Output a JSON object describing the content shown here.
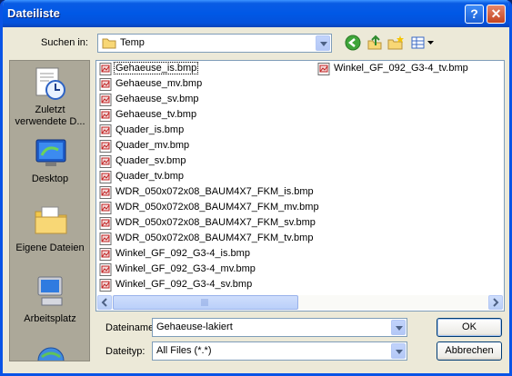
{
  "window": {
    "title": "Dateiliste"
  },
  "titlebar_buttons": {
    "help": "?",
    "close": "✕"
  },
  "lookin": {
    "label": "Suchen in:",
    "value": "Temp"
  },
  "toolbar_icons": [
    "back-icon",
    "up-folder-icon",
    "new-folder-icon",
    "view-menu-icon"
  ],
  "places": [
    {
      "label": "Zuletzt verwendete D...",
      "icon": "recent-icon"
    },
    {
      "label": "Desktop",
      "icon": "desktop-icon"
    },
    {
      "label": "Eigene Dateien",
      "icon": "my-documents-icon"
    },
    {
      "label": "Arbeitsplatz",
      "icon": "my-computer-icon"
    },
    {
      "label": "",
      "icon": "network-icon"
    }
  ],
  "files_col1": [
    "Gehaeuse_is.bmp",
    "Gehaeuse_mv.bmp",
    "Gehaeuse_sv.bmp",
    "Gehaeuse_tv.bmp",
    "Quader_is.bmp",
    "Quader_mv.bmp",
    "Quader_sv.bmp",
    "Quader_tv.bmp",
    "WDR_050x072x08_BAUM4X7_FKM_is.bmp",
    "WDR_050x072x08_BAUM4X7_FKM_mv.bmp",
    "WDR_050x072x08_BAUM4X7_FKM_sv.bmp",
    "WDR_050x072x08_BAUM4X7_FKM_tv.bmp",
    "Winkel_GF_092_G3-4_is.bmp",
    "Winkel_GF_092_G3-4_mv.bmp",
    "Winkel_GF_092_G3-4_sv.bmp"
  ],
  "files_col2": [
    "Winkel_GF_092_G3-4_tv.bmp"
  ],
  "filename": {
    "label": "Dateiname:",
    "value": "Gehaeuse-lakiert"
  },
  "filetype": {
    "label": "Dateityp:",
    "value": "All Files (*.*)"
  },
  "buttons": {
    "ok": "OK",
    "cancel": "Abbrechen"
  },
  "colors": {
    "titlebar": "#0058E6",
    "dialog_bg": "#ECE9D8",
    "places_bg": "#ACA899"
  }
}
